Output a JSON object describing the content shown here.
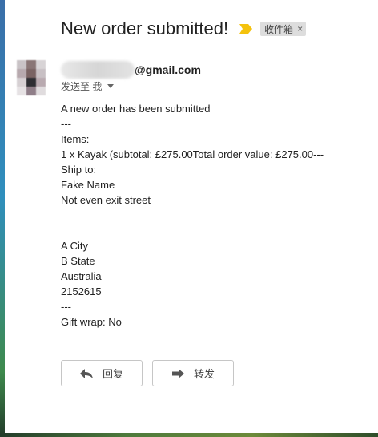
{
  "email": {
    "subject": "New order submitted!",
    "label": "收件箱",
    "label_close": "×",
    "sender_domain": "@gmail.com",
    "to_line": "发送至 我",
    "body_lines": [
      "A new order has been submitted",
      "---",
      "Items:",
      "1 x Kayak (subtotal: £275.00Total order value: £275.00---",
      "Ship to:",
      "Fake Name",
      "Not even exit street",
      "",
      "",
      "A City",
      "B State",
      "Australia",
      "2152615",
      "---",
      "Gift wrap: No"
    ],
    "reply_label": "回复",
    "forward_label": "转发"
  },
  "icons": {
    "importance": "importance-marker-icon",
    "reply": "reply-arrow-icon",
    "forward": "forward-arrow-icon",
    "caret": "chevron-down-icon"
  },
  "colors": {
    "importance_marker": "#f4c20d",
    "label_chip": "#dddddd"
  }
}
